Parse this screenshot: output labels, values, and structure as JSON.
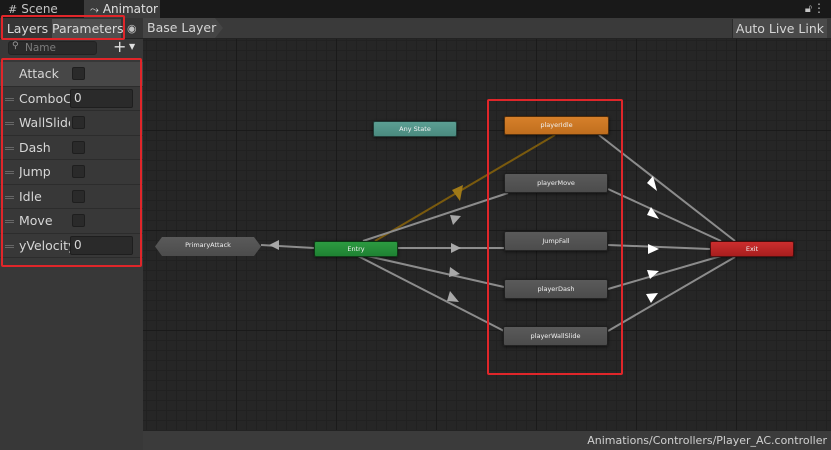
{
  "window": {
    "tabs": [
      {
        "label": "Scene",
        "icon": "grid-icon"
      },
      {
        "label": "Animator",
        "icon": "animator-icon"
      }
    ],
    "right_icons": [
      "lock-icon",
      "menu-icon"
    ]
  },
  "left_panel": {
    "toolbar": {
      "layers_label": "Layers",
      "parameters_label": "Parameters",
      "active": "Parameters"
    },
    "search": {
      "placeholder": "Name",
      "value": ""
    },
    "parameters": [
      {
        "name": "Attack",
        "type": "trigger",
        "value": false
      },
      {
        "name": "ComboCounter",
        "type": "int",
        "value": "0"
      },
      {
        "name": "WallSlide",
        "type": "bool",
        "value": false
      },
      {
        "name": "Dash",
        "type": "bool",
        "value": false
      },
      {
        "name": "Jump",
        "type": "bool",
        "value": false
      },
      {
        "name": "Idle",
        "type": "bool",
        "value": false
      },
      {
        "name": "Move",
        "type": "bool",
        "value": false
      },
      {
        "name": "yVelocity",
        "type": "float",
        "value": "0"
      }
    ]
  },
  "breadcrumb": {
    "layer": "Base Layer"
  },
  "toolbar_right": {
    "auto_live_link_label": "Auto Live Link"
  },
  "graph": {
    "states": {
      "any_state": "Any State",
      "player_idle": "playerIdle",
      "player_move": "playerMove",
      "jump_fall": "JumpFall",
      "player_dash": "playerDash",
      "player_wall_slide": "playerWallSlide",
      "entry": "Entry",
      "exit": "Exit",
      "primary_attack": "PrimaryAttack"
    },
    "default_state": "playerIdle",
    "colors": {
      "any_state": "#4f9186",
      "default_state": "#cc7622",
      "entry": "#258c3a",
      "exit": "#b82424",
      "state": "#545454",
      "transition": "#8c8c8c",
      "default_transition": "#7a5a0e",
      "highlight": "#e0262a"
    }
  },
  "status_bar": {
    "controller_path": "Animations/Controllers/Player_AC.controller"
  }
}
